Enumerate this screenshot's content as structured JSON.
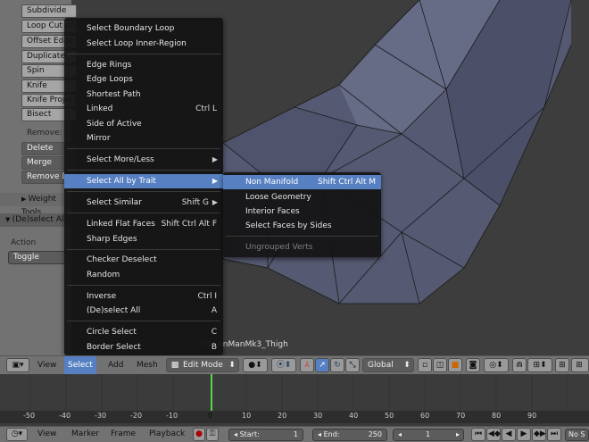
{
  "toolshelf": {
    "buttons": [
      "Subdivide",
      "Loop Cut and Slide",
      "Offset Edge Slide",
      "Duplicate",
      "Spin",
      "Knife",
      "Knife Project",
      "Bisect"
    ],
    "remove_label": "Remove:",
    "remove_buttons": [
      "Delete",
      "Merge",
      "Remove Doubles"
    ],
    "weight_tools": "Weight Tools",
    "operator_panel": "(De)select All",
    "action_label": "Action",
    "action_value": "Toggle"
  },
  "select_menu": {
    "items": [
      {
        "label": "Select Boundary Loop",
        "shortcut": ""
      },
      {
        "label": "Select Loop Inner-Region",
        "shortcut": ""
      },
      {
        "label": "Edge Rings",
        "shortcut": ""
      },
      {
        "label": "Edge Loops",
        "shortcut": ""
      },
      {
        "label": "Shortest Path",
        "shortcut": ""
      },
      {
        "label": "Linked",
        "shortcut": "Ctrl L"
      },
      {
        "label": "Side of Active",
        "shortcut": ""
      },
      {
        "label": "Mirror",
        "shortcut": ""
      },
      {
        "label": "Select More/Less",
        "shortcut": ""
      },
      {
        "label": "Select All by Trait",
        "shortcut": ""
      },
      {
        "label": "Select Similar",
        "shortcut": "Shift G"
      },
      {
        "label": "Linked Flat Faces",
        "shortcut": "Shift Ctrl Alt F"
      },
      {
        "label": "Sharp Edges",
        "shortcut": ""
      },
      {
        "label": "Checker Deselect",
        "shortcut": ""
      },
      {
        "label": "Random",
        "shortcut": ""
      },
      {
        "label": "Inverse",
        "shortcut": "Ctrl I"
      },
      {
        "label": "(De)select All",
        "shortcut": "A"
      },
      {
        "label": "Circle Select",
        "shortcut": "C"
      },
      {
        "label": "Border Select",
        "shortcut": "B"
      }
    ]
  },
  "trait_submenu": {
    "items": [
      {
        "label": "Non Manifold",
        "shortcut": "Shift Ctrl Alt M"
      },
      {
        "label": "Loose Geometry",
        "shortcut": ""
      },
      {
        "label": "Interior Faces",
        "shortcut": ""
      },
      {
        "label": "Select Faces by Sides",
        "shortcut": ""
      },
      {
        "label": "Ungrouped Verts",
        "shortcut": ""
      }
    ]
  },
  "viewport": {
    "object_name": "(1) AnManMk3_Thigh"
  },
  "header3d": {
    "menus": [
      "View",
      "Select",
      "Add",
      "Mesh"
    ],
    "mode": "Edit Mode",
    "pivot": "Global"
  },
  "timeline": {
    "ticks": [
      "-50",
      "-40",
      "-30",
      "-20",
      "-10",
      "0",
      "10",
      "20",
      "30",
      "40",
      "50",
      "60",
      "70",
      "80",
      "90"
    ]
  },
  "timehdr": {
    "menus": [
      "View",
      "Marker",
      "Frame",
      "Playback"
    ],
    "start": {
      "label": "Start:",
      "value": "1"
    },
    "end": {
      "label": "End:",
      "value": "250"
    },
    "current": "1",
    "sync": "No S"
  },
  "colors": {
    "highlight": "#5680c2",
    "menu_bg": "#141414",
    "frame_marker": "#5ad84a"
  }
}
